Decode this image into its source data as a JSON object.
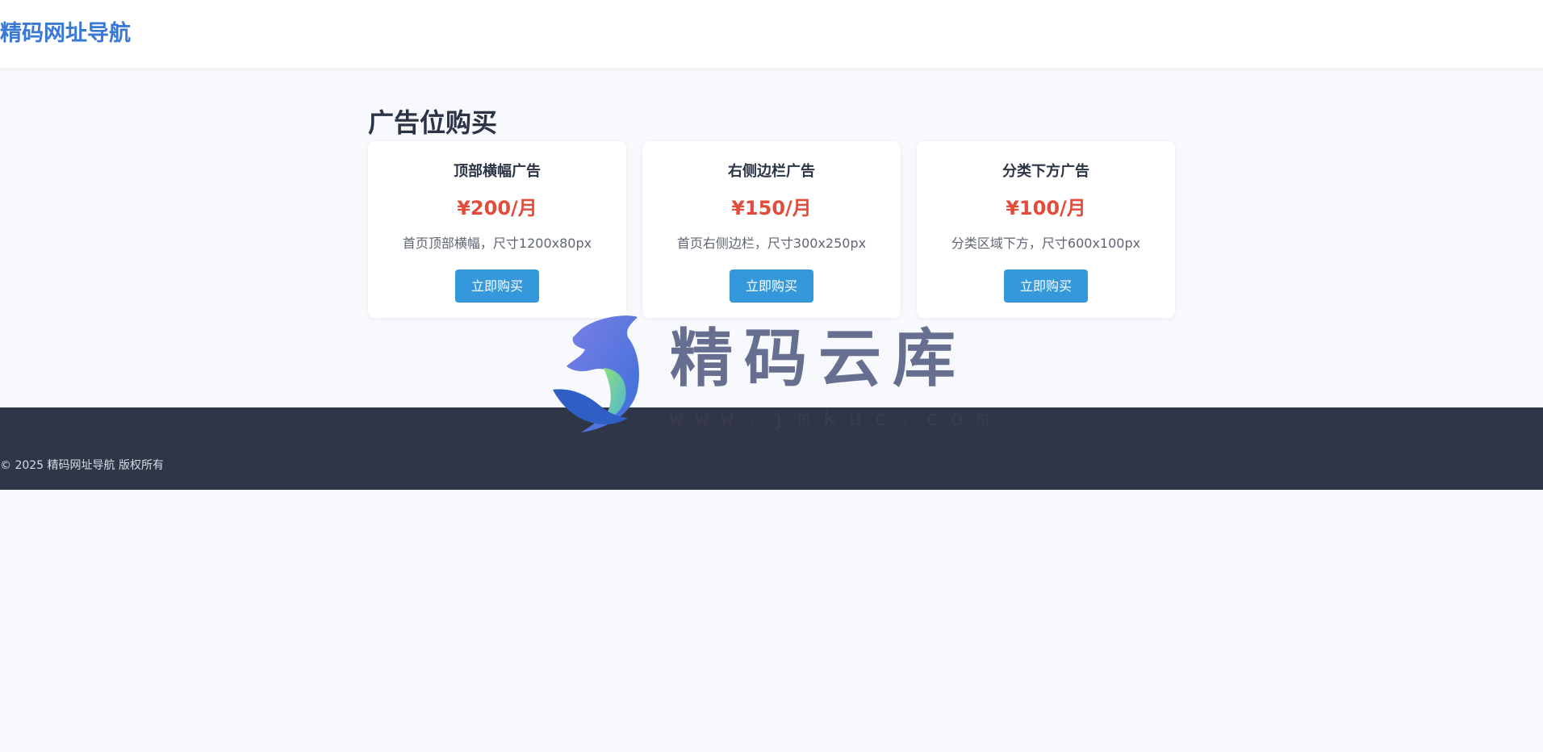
{
  "header": {
    "site_title": "精码网址导航"
  },
  "main": {
    "title": "广告位购买",
    "cards": [
      {
        "title": "顶部横幅广告",
        "price": "¥200/月",
        "desc": "首页顶部横幅，尺寸1200x80px",
        "button": "立即购买"
      },
      {
        "title": "右侧边栏广告",
        "price": "¥150/月",
        "desc": "首页右侧边栏，尺寸300x250px",
        "button": "立即购买"
      },
      {
        "title": "分类下方广告",
        "price": "¥100/月",
        "desc": "分类区域下方，尺寸600x100px",
        "button": "立即购买"
      }
    ]
  },
  "watermark": {
    "brand": "精码云库",
    "url": "www.jmkuc.com"
  },
  "footer": {
    "copyright": "© 2025 精码网址导航 版权所有"
  },
  "colors": {
    "brand_blue": "#3a78d6",
    "price_red": "#e24c3b",
    "button_blue": "#3498db",
    "footer_bg": "#2e3648"
  }
}
